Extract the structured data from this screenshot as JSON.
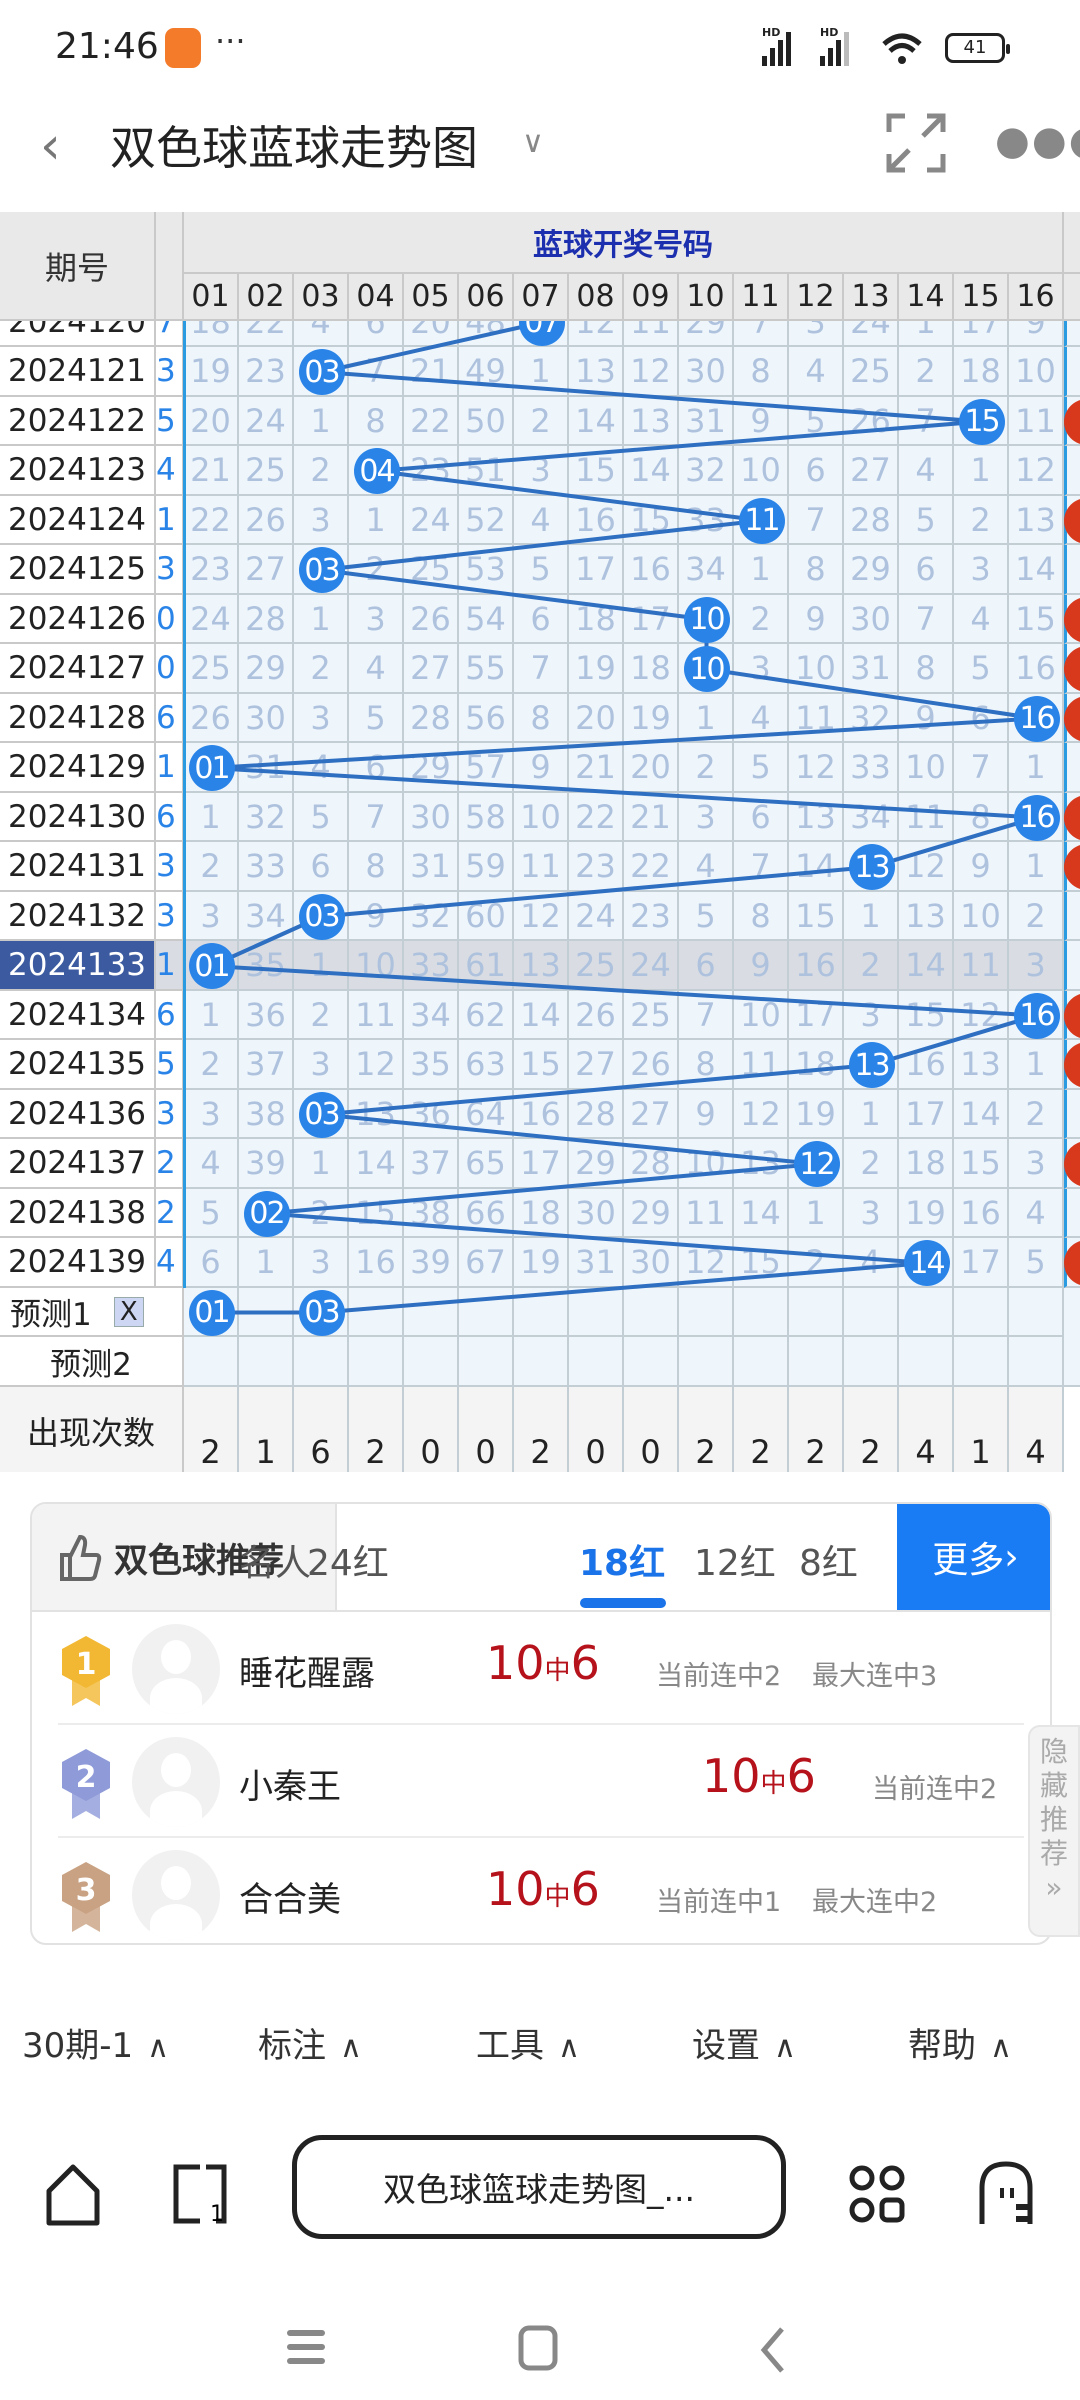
{
  "status_bar": {
    "time": "21:46",
    "battery": "41",
    "icons": [
      "shopping-app-icon",
      "more-dots-icon",
      "hd-signal-icon",
      "hd-signal-icon",
      "wifi-icon",
      "battery-icon"
    ]
  },
  "titlebar": {
    "title": "双色球蓝球走势图",
    "icons": [
      "back-icon",
      "chevron-down-icon",
      "fullscreen-icon",
      "more-icon"
    ]
  },
  "table": {
    "period_header": "期号",
    "group_header": "蓝球开奖号码",
    "columns": [
      "01",
      "02",
      "03",
      "04",
      "05",
      "06",
      "07",
      "08",
      "09",
      "10",
      "11",
      "12",
      "13",
      "14",
      "15",
      "16"
    ],
    "highlight_period": "2024133",
    "colors": {
      "ball": "#2a84e8",
      "red_ball": "#d8391c",
      "highlight_label": "#3b5aa0",
      "highlight_row": "#d9dde3",
      "cell_bg": "#eef6fc",
      "omission_text": "#aec2de"
    },
    "rows": [
      {
        "period": "2024120",
        "edge": "7",
        "cells": [
          18,
          22,
          4,
          6,
          20,
          48,
          "07",
          12,
          11,
          29,
          7,
          3,
          24,
          1,
          17,
          9
        ],
        "red": false
      },
      {
        "period": "2024121",
        "edge": "3",
        "cells": [
          19,
          23,
          "03",
          7,
          21,
          49,
          1,
          13,
          12,
          30,
          8,
          4,
          25,
          2,
          18,
          10
        ],
        "red": false
      },
      {
        "period": "2024122",
        "edge": "5",
        "cells": [
          20,
          24,
          1,
          8,
          22,
          50,
          2,
          14,
          13,
          31,
          9,
          5,
          26,
          7,
          "15",
          11
        ],
        "red": true
      },
      {
        "period": "2024123",
        "edge": "4",
        "cells": [
          21,
          25,
          2,
          "04",
          23,
          51,
          3,
          15,
          14,
          32,
          10,
          6,
          27,
          4,
          1,
          12
        ],
        "red": false
      },
      {
        "period": "2024124",
        "edge": "1",
        "cells": [
          22,
          26,
          3,
          1,
          24,
          52,
          4,
          16,
          15,
          33,
          "11",
          7,
          28,
          5,
          2,
          13
        ],
        "red": true
      },
      {
        "period": "2024125",
        "edge": "3",
        "cells": [
          23,
          27,
          "03",
          2,
          25,
          53,
          5,
          17,
          16,
          34,
          1,
          8,
          29,
          6,
          3,
          14
        ],
        "red": false
      },
      {
        "period": "2024126",
        "edge": "0",
        "cells": [
          24,
          28,
          1,
          3,
          26,
          54,
          6,
          18,
          17,
          "10",
          2,
          9,
          30,
          7,
          4,
          15
        ],
        "red": true
      },
      {
        "period": "2024127",
        "edge": "0",
        "cells": [
          25,
          29,
          2,
          4,
          27,
          55,
          7,
          19,
          18,
          "10",
          3,
          10,
          31,
          8,
          5,
          16
        ],
        "red": true
      },
      {
        "period": "2024128",
        "edge": "6",
        "cells": [
          26,
          30,
          3,
          5,
          28,
          56,
          8,
          20,
          19,
          1,
          4,
          11,
          32,
          9,
          6,
          "16"
        ],
        "red": true
      },
      {
        "period": "2024129",
        "edge": "1",
        "cells": [
          "01",
          31,
          4,
          6,
          29,
          57,
          9,
          21,
          20,
          2,
          5,
          12,
          33,
          10,
          7,
          1
        ],
        "red": false
      },
      {
        "period": "2024130",
        "edge": "6",
        "cells": [
          1,
          32,
          5,
          7,
          30,
          58,
          10,
          22,
          21,
          3,
          6,
          13,
          34,
          11,
          8,
          "16"
        ],
        "red": true
      },
      {
        "period": "2024131",
        "edge": "3",
        "cells": [
          2,
          33,
          6,
          8,
          31,
          59,
          11,
          23,
          22,
          4,
          7,
          14,
          "13",
          12,
          9,
          1
        ],
        "red": true
      },
      {
        "period": "2024132",
        "edge": "3",
        "cells": [
          3,
          34,
          "03",
          9,
          32,
          60,
          12,
          24,
          23,
          5,
          8,
          15,
          1,
          13,
          10,
          2
        ],
        "red": false
      },
      {
        "period": "2024133",
        "edge": "1",
        "cells": [
          "01",
          35,
          1,
          10,
          33,
          61,
          13,
          25,
          24,
          6,
          9,
          16,
          2,
          14,
          11,
          3
        ],
        "red": false
      },
      {
        "period": "2024134",
        "edge": "6",
        "cells": [
          1,
          36,
          2,
          11,
          34,
          62,
          14,
          26,
          25,
          7,
          10,
          17,
          3,
          15,
          12,
          "16"
        ],
        "red": true
      },
      {
        "period": "2024135",
        "edge": "5",
        "cells": [
          2,
          37,
          3,
          12,
          35,
          63,
          15,
          27,
          26,
          8,
          11,
          18,
          "13",
          16,
          13,
          1
        ],
        "red": true
      },
      {
        "period": "2024136",
        "edge": "3",
        "cells": [
          3,
          38,
          "03",
          13,
          36,
          64,
          16,
          28,
          27,
          9,
          12,
          19,
          1,
          17,
          14,
          2
        ],
        "red": false
      },
      {
        "period": "2024137",
        "edge": "2",
        "cells": [
          4,
          39,
          1,
          14,
          37,
          65,
          17,
          29,
          28,
          10,
          13,
          "12",
          2,
          18,
          15,
          3
        ],
        "red": true
      },
      {
        "period": "2024138",
        "edge": "2",
        "cells": [
          5,
          "02",
          2,
          15,
          38,
          66,
          18,
          30,
          29,
          11,
          14,
          1,
          3,
          19,
          16,
          4
        ],
        "red": false
      },
      {
        "period": "2024139",
        "edge": "4",
        "cells": [
          6,
          1,
          3,
          16,
          39,
          67,
          19,
          31,
          30,
          12,
          15,
          2,
          4,
          "14",
          17,
          5
        ],
        "red": true
      }
    ],
    "predict1": {
      "label": "预测1",
      "close": "X",
      "balls": [
        "01",
        "03"
      ]
    },
    "predict2": {
      "label": "预测2"
    },
    "count_label": "出现次数",
    "counts": [
      2,
      1,
      6,
      2,
      0,
      0,
      2,
      0,
      0,
      2,
      2,
      2,
      2,
      4,
      1,
      4
    ]
  },
  "recommend": {
    "title": "双色球推荐",
    "tabs": [
      {
        "label": "名人"
      },
      {
        "label": "24红"
      },
      {
        "label": "18红",
        "active": true
      },
      {
        "label": "12红"
      },
      {
        "label": "8红"
      }
    ],
    "more": "更多",
    "items": [
      {
        "rank": "1",
        "name": "睡花醒露",
        "hits": "10",
        "mid": "中",
        "hit": "6",
        "current": "当前连中2",
        "max": "最大连中3",
        "medal_color": "#f2b833"
      },
      {
        "rank": "2",
        "name": "小秦王",
        "hits": "10",
        "mid": "中",
        "hit": "6",
        "current": "当前连中2",
        "medal_color": "#8f9ad8"
      },
      {
        "rank": "3",
        "name": "合合美",
        "hits": "10",
        "mid": "中",
        "hit": "6",
        "current": "当前连中1",
        "max": "最大连中2",
        "medal_color": "#c9a283"
      }
    ],
    "hide_tab": "隐藏推荐"
  },
  "bottom_menu": [
    {
      "label": "30期-1"
    },
    {
      "label": "标注"
    },
    {
      "label": "工具"
    },
    {
      "label": "设置"
    },
    {
      "label": "帮助"
    }
  ],
  "browser": {
    "url_text": "双色球篮球走势图_..."
  }
}
